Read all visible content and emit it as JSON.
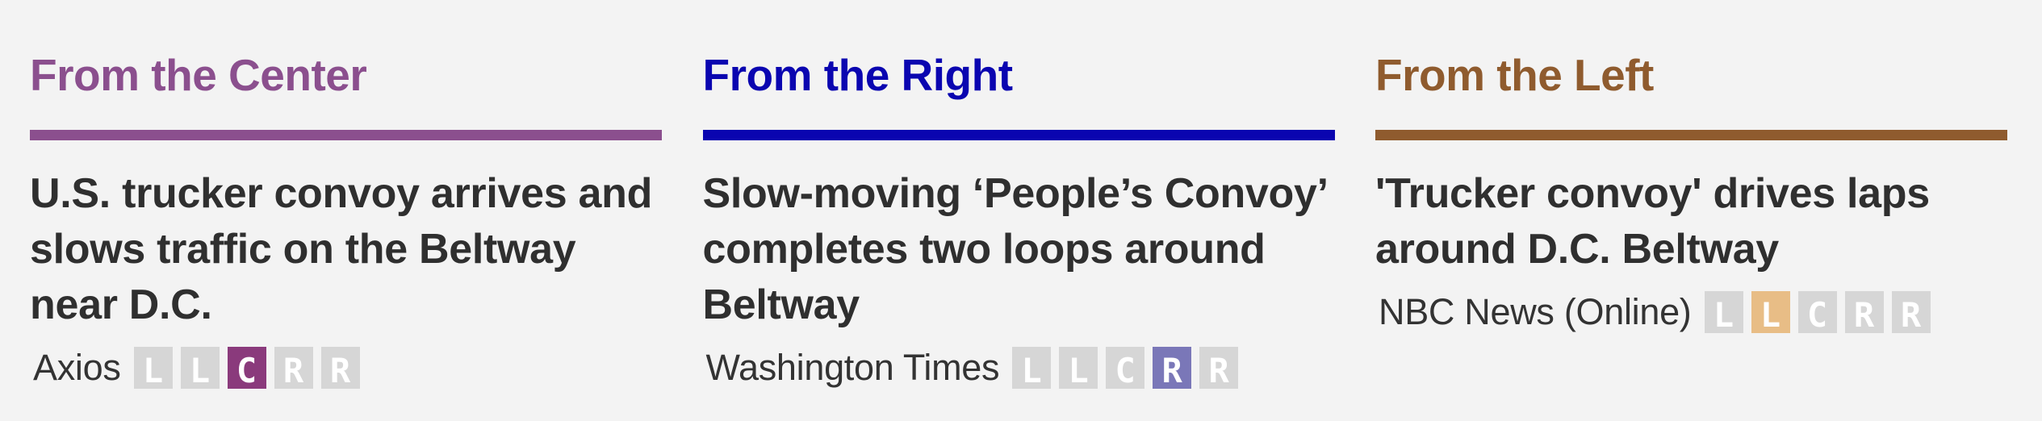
{
  "colors": {
    "center": "#8b4f8e",
    "right": "#0a05b0",
    "left": "#8f5b2e",
    "headline": "#2f2f2f",
    "bias_inactive": "#d6d6d6",
    "bias_center_active": "#8a3a7c",
    "bias_right_active": "#7a77b8",
    "bias_lean_left_active": "#e8bd86"
  },
  "columns": [
    {
      "heading": "From the Center",
      "color": "#8b4f8e",
      "headline": "U.S. trucker convoy arrives and slows traffic on the Beltway near D.C.",
      "source": "Axios",
      "bias_rating": "Center",
      "bias_boxes": [
        {
          "letter": "L",
          "label": "Left",
          "active": false
        },
        {
          "letter": "L",
          "label": "Lean Left",
          "active": false
        },
        {
          "letter": "C",
          "label": "Center",
          "active": true
        },
        {
          "letter": "R",
          "label": "Lean Right",
          "active": false
        },
        {
          "letter": "R",
          "label": "Right",
          "active": false
        }
      ]
    },
    {
      "heading": "From the Right",
      "color": "#0a05b0",
      "headline": "Slow-moving ‘People’s Convoy’ completes two loops around Beltway",
      "source": "Washington Times",
      "bias_rating": "Lean Right",
      "bias_boxes": [
        {
          "letter": "L",
          "label": "Left",
          "active": false
        },
        {
          "letter": "L",
          "label": "Lean Left",
          "active": false
        },
        {
          "letter": "C",
          "label": "Center",
          "active": false
        },
        {
          "letter": "R",
          "label": "Lean Right",
          "active": true
        },
        {
          "letter": "R",
          "label": "Right",
          "active": false
        }
      ]
    },
    {
      "heading": "From the Left",
      "color": "#8f5b2e",
      "headline": "'Trucker convoy' drives laps around D.C. Beltway",
      "source": "NBC News (Online)",
      "bias_rating": "Lean Left",
      "bias_boxes": [
        {
          "letter": "L",
          "label": "Left",
          "active": false
        },
        {
          "letter": "L",
          "label": "Lean Left",
          "active": true
        },
        {
          "letter": "C",
          "label": "Center",
          "active": false
        },
        {
          "letter": "R",
          "label": "Lean Right",
          "active": false
        },
        {
          "letter": "R",
          "label": "Right",
          "active": false
        }
      ]
    }
  ]
}
